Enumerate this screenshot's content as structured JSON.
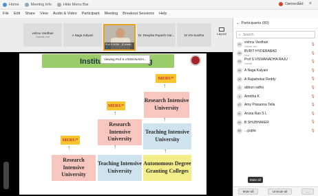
{
  "titlebar": {
    "tabs": [
      {
        "label": "Home",
        "icon": "zoom-icon"
      },
      {
        "label": "Meeting Info",
        "icon": "info-icon"
      },
      {
        "label": "Hide Menu Bar",
        "icon": "eye-icon"
      }
    ],
    "connection": "Connected"
  },
  "menu": [
    "File",
    "Edit",
    "Share",
    "View",
    "Audio & Video",
    "Participant",
    "Meeting",
    "Breakout Sessions",
    "Help"
  ],
  "video_strip": {
    "tiles": [
      {
        "name": "vishnu Vardhan",
        "sub": "Cohost, me"
      },
      {
        "name": "A Naga Kalyani",
        "sub": ""
      },
      {
        "name": "Dr. Deepika Rupesh Gar...",
        "sub": ""
      },
      {
        "name": "Dr KN Sunitha",
        "sub": ""
      }
    ],
    "active_video_label": "Prof S.VISW... (Cohost) 👤",
    "layout_label": "Layout"
  },
  "share": {
    "viewing_label": "Viewing Prof S.VISWANADH...",
    "slide_title_left": "Institu",
    "slide_title_right": "ng",
    "meru": "MERU*",
    "boxes": {
      "top": "Research Intensive University",
      "mid_left": "Research Intensive University",
      "mid_right": "Teaching Intensive University",
      "low_left": "Research Intensive University",
      "low_mid": "Teaching Intensive University",
      "low_right": "Autonomous Degree Granting Colleges"
    }
  },
  "panel": {
    "header": "Participants (80)",
    "search_placeholder": "Search",
    "participants": [
      {
        "initials": "VV",
        "name": "vishnu Vardhan",
        "sub": "Cohost, me"
      },
      {
        "initials": "BH",
        "name": "BVRIT HYDERABAD",
        "sub": "Host"
      },
      {
        "initials": "PS",
        "name": "Prof S.VISWANADHA RAJU",
        "sub": "Cohost"
      },
      {
        "initials": "AK",
        "name": "A Naga Kalyani",
        "sub": ""
      },
      {
        "initials": "AR",
        "name": "A Rajashekar Reddy",
        "sub": ""
      },
      {
        "initials": "A",
        "name": "abburi radha",
        "sub": ""
      },
      {
        "initials": "A",
        "name": "Amritha K",
        "sub": ""
      },
      {
        "initials": "AT",
        "name": "Amy Prasanna Tella",
        "sub": ""
      },
      {
        "initials": "AL",
        "name": "Aruna Rao S L",
        "sub": ""
      },
      {
        "initials": "BS",
        "name": "B SHUBHAKER",
        "sub": ""
      },
      {
        "initials": "BS",
        "name": "...gupta",
        "sub": ""
      }
    ],
    "mute_all": "Mute all",
    "unmute_all": "Unmute all",
    "tooltip": "Mute all"
  }
}
